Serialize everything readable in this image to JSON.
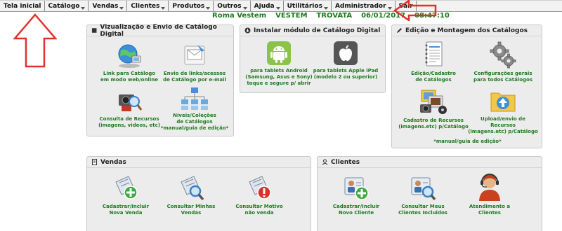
{
  "menu": {
    "items": [
      {
        "label": "Tela inicial",
        "caret": false
      },
      {
        "label": "Catálogo",
        "caret": true
      },
      {
        "label": "Vendas",
        "caret": true
      },
      {
        "label": "Clientes",
        "caret": true
      },
      {
        "label": "Produtos",
        "caret": true
      },
      {
        "label": "Outros",
        "caret": true
      },
      {
        "label": "Ajuda",
        "caret": true
      },
      {
        "label": "Utilitários",
        "caret": true
      },
      {
        "label": "Administrador",
        "caret": true
      },
      {
        "label": "Sair",
        "caret": false
      }
    ]
  },
  "status": {
    "company": "Roma Vestem",
    "code": "VESTEM",
    "user": "TROVATA",
    "date": "06/01/2017",
    "time": "08:47:10"
  },
  "colors": {
    "label_green": "#1f7a1f",
    "arrow_red": "#e0302a",
    "panel_bg": "#ececec"
  },
  "panels": {
    "catalog_view": {
      "title": "Vizualização e Envio de Catálogo Digital",
      "icon": "square-icon",
      "tiles": [
        {
          "label": "Link para Catálogo\nem modo web/online",
          "icon": "globe-link-icon"
        },
        {
          "label": "Envio de links/acessos\nde Catálogo por e-mail",
          "icon": "email-envelope-icon"
        },
        {
          "label": "Consulta de Recursos\n(imagens, videos, etc)",
          "icon": "camera-magnifier-icon"
        },
        {
          "label": "Níveis/Coleções\nde Catálogos\n*manual/guia de edição*",
          "icon": "hierarchy-icon"
        }
      ]
    },
    "install_module": {
      "title": "Instalar módulo de Catálogo Digital",
      "icon": "download-circle-icon",
      "tiles": [
        {
          "label": "para tablets Android\n(Samsung, Asus e Sony)\ntoque e segure p/ abrir",
          "icon": "android-icon"
        },
        {
          "label": "para tablets Apple iPad\n(modelo 2 ou superior)",
          "icon": "apple-icon"
        }
      ]
    },
    "catalog_edit": {
      "title": "Edição e Montagem dos Catálogos",
      "icon": "pencil-icon",
      "tiles": [
        {
          "label": "Edição/Cadastro\nde Catálogos",
          "icon": "notebook-icon"
        },
        {
          "label": "Configurações gerais\npara todos Catálogos",
          "icon": "gears-icon"
        },
        {
          "label": "Cadastro de Recursos\n(imagens.etc) p/Catálogo",
          "icon": "media-resources-icon"
        },
        {
          "label": "Upload/envio de\nRecursos\n(imagens.etc) p/Catálogo",
          "icon": "upload-folder-icon"
        }
      ],
      "footnote": "*manual/guia de edição*"
    },
    "sales": {
      "title": "Vendas",
      "icon": "document-icon",
      "tiles": [
        {
          "label": "Cadastrar/Incluir\nNova Venda",
          "icon": "add-sale-icon"
        },
        {
          "label": "Consultar Minhas\nVendas",
          "icon": "search-sale-icon"
        },
        {
          "label": "Consultar Motivo\nnão venda",
          "icon": "no-sale-icon"
        }
      ]
    },
    "clients": {
      "title": "Clientes",
      "icon": "user-icon",
      "tiles": [
        {
          "label": "Cadastrar/Incluir\nNovo Cliente",
          "icon": "add-client-icon"
        },
        {
          "label": "Consultar Meus\nClientes Incluidos",
          "icon": "search-client-icon"
        },
        {
          "label": "Atendimento a\nClientes",
          "icon": "support-agent-icon"
        }
      ]
    }
  }
}
